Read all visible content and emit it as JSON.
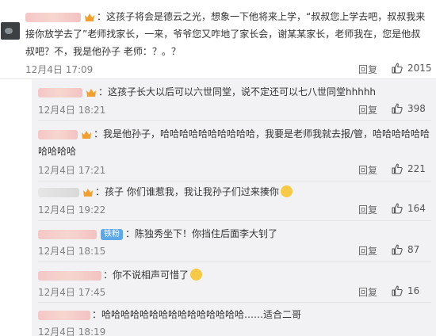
{
  "top_comment": {
    "text": "：这孩子将会是德云之光，想象一下他将来上学，“叔叔您上学去吧，叔叔我来接你放学去了”老师找家长，一来，爷爷您又咋地了家长会，谢某某家长，老师我在，您是他叔叔吧？不，我是他孙子 老师：？。？",
    "time": "12月4日 17:09",
    "reply_label": "回复",
    "likes": "2015"
  },
  "replies": [
    {
      "text": "：这孩子长大以后可以六世同堂，说不定还可以七八世同堂hhhhh",
      "time": "12月4日 18:21",
      "reply_label": "回复",
      "likes": "398"
    },
    {
      "text": "：我是他孙子，哈哈哈哈哈哈哈哈哈哈，我要是老师我就去报/管，哈哈哈哈哈哈哈哈哈哈",
      "time": "12月4日 17:21",
      "reply_label": "回复",
      "likes": "221"
    },
    {
      "text": "：孩子 你们谁惹我，我让我孙子们过来揍你",
      "time": "12月4日 19:22",
      "reply_label": "回复",
      "likes": "164"
    },
    {
      "badge": "铁粉",
      "text": "：陈独秀坐下！你挡住后面李大钊了",
      "time": "12月4日 18:15",
      "reply_label": "回复",
      "likes": "87"
    },
    {
      "text": "：你不说相声可惜了",
      "time": "12月4日 17:45",
      "reply_label": "回复",
      "likes": "16"
    },
    {
      "text": "：哈哈哈哈哈哈哈哈哈哈哈哈哈哈哈……适合二哥",
      "time": "12月4日 18:19",
      "reply_label": "",
      "likes": ""
    }
  ]
}
